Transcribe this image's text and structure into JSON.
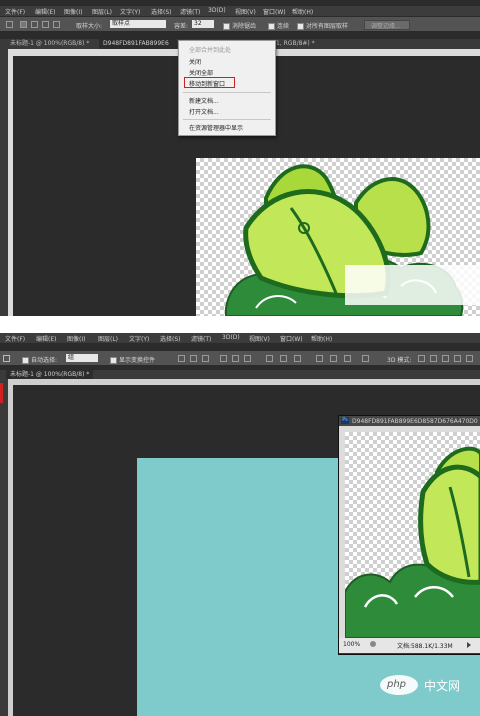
{
  "menu": [
    "文件(F)",
    "编辑(E)",
    "图像(I)",
    "图层(L)",
    "文字(Y)",
    "选择(S)",
    "滤镜(T)",
    "3D(D)",
    "视图(V)",
    "窗口(W)",
    "帮助(H)"
  ],
  "top": {
    "options": {
      "sample_size_label": "取样大小:",
      "sample_size_value": "取样点",
      "tolerance_label": "容差:",
      "tolerance_value": "32",
      "antialias": "消除锯齿",
      "contiguous": "连续",
      "all_layers": "对所有图层取样",
      "refine_edge": "调整边缘..."
    },
    "tabs": [
      "未标题-1 @ 100%(RGB/8) *",
      "D948FD891FAB899E6",
      "1, RGB/8#) *"
    ],
    "context_menu": {
      "items": [
        "全部合并到此处",
        "关闭",
        "关闭全部",
        "移动到新窗口",
        "新建文档...",
        "打开文档...",
        "在资源管理器中显示"
      ],
      "highlighted": "移动到新窗口"
    }
  },
  "bottom": {
    "options": {
      "auto_select_label": "自动选择:",
      "auto_select_value": "组",
      "transform_controls": "显示变换控件",
      "mode_3d": "3D 模式:"
    },
    "tab": "未标题-1 @ 100%(RGB/8) *",
    "float_window": {
      "title": "D948FD891FAB899E6D8587D676A470D0",
      "zoom": "100%",
      "doc_info": "文档:588.1K/1.33M"
    }
  },
  "watermark": {
    "text": "中文网",
    "logo": "php"
  },
  "colors": {
    "canvas_teal": "#7fcacb",
    "dark_bg": "#2b2b2b",
    "highlight_border": "#d02020"
  }
}
